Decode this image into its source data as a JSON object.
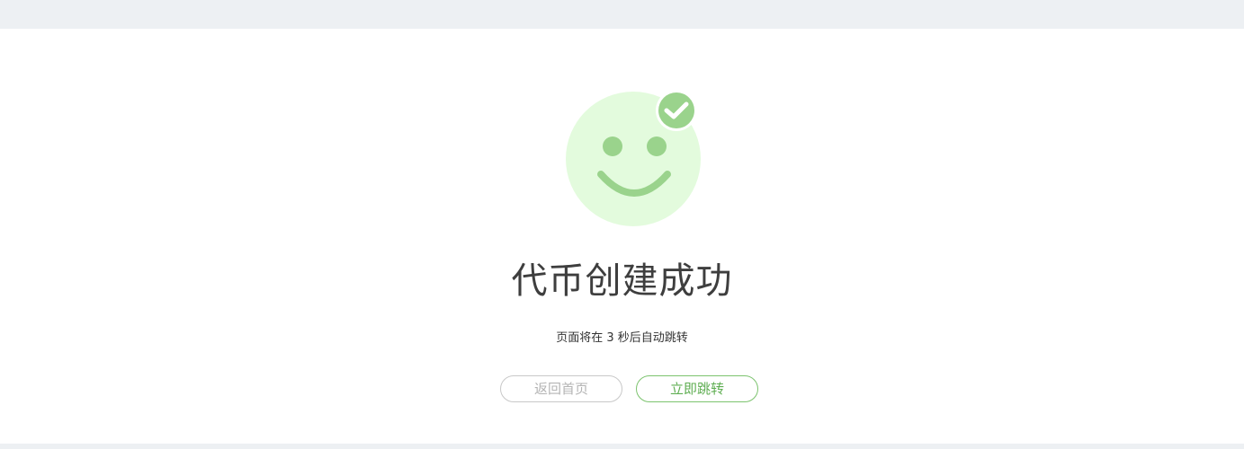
{
  "result": {
    "title": "代币创建成功",
    "redirect_notice": "页面将在 3 秒后自动跳转",
    "illustration_icon": "smiley-success-icon",
    "badge_icon": "check-icon"
  },
  "actions": {
    "home_label": "返回首页",
    "go_now_label": "立即跳转"
  },
  "colors": {
    "face_fill": "#e3fbdd",
    "face_features": "#9ad38c",
    "badge": "#9ad38c",
    "primary_button": "#5fae52",
    "title": "#3e3e3e"
  }
}
